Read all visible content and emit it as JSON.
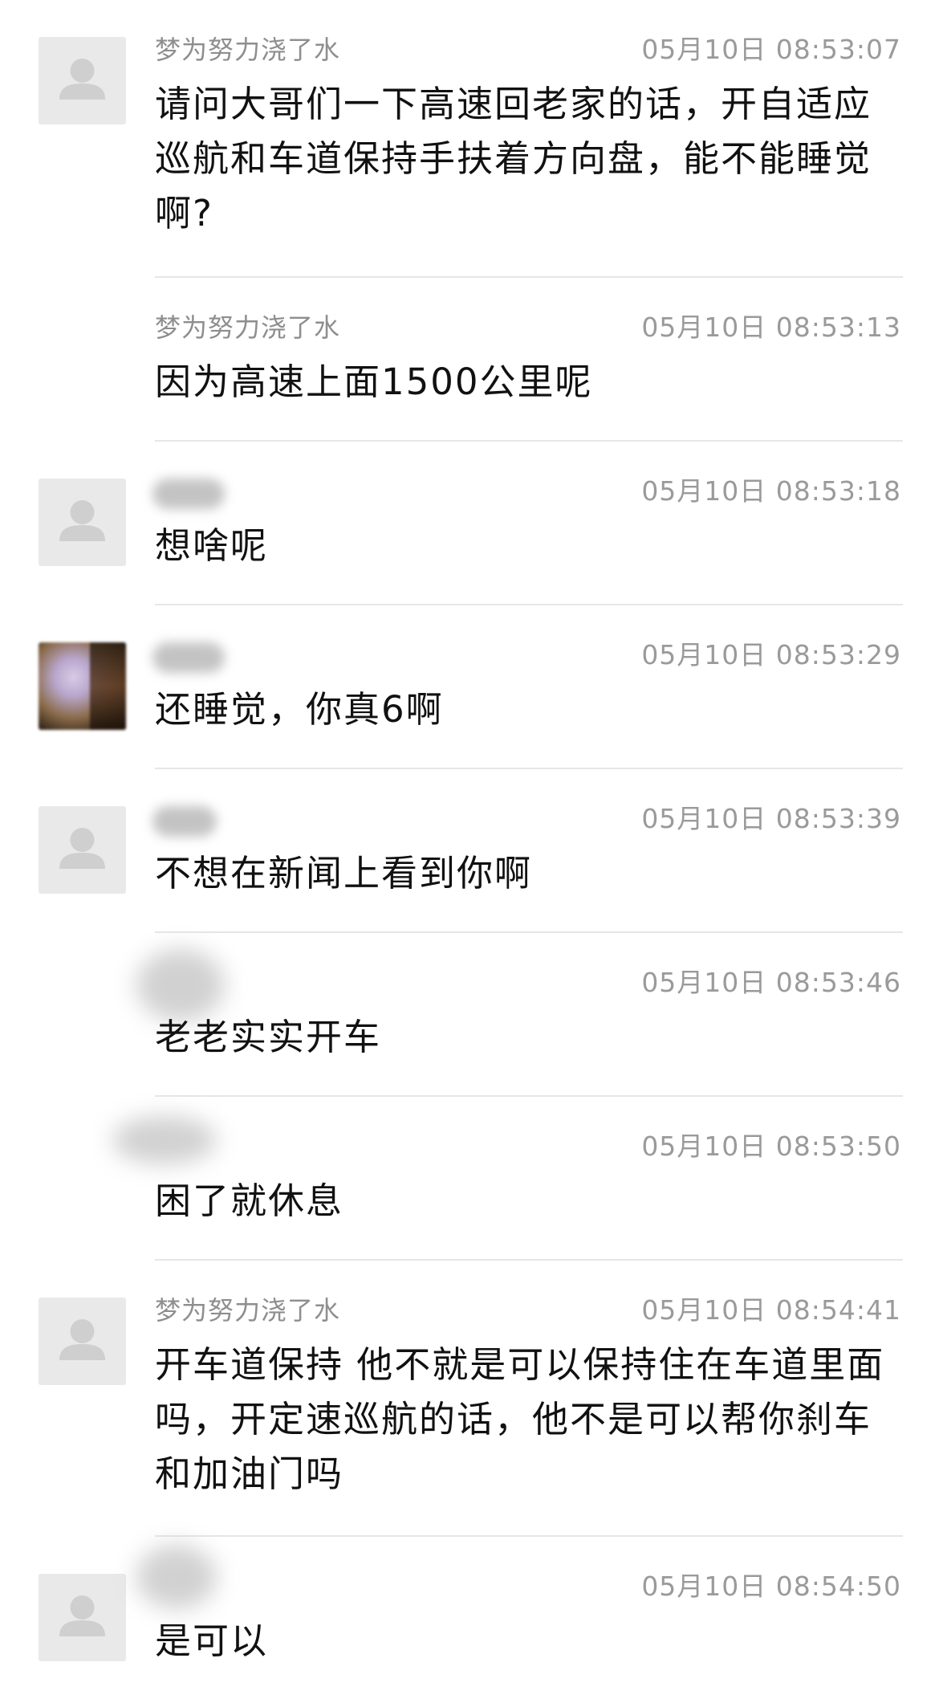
{
  "messages": [
    {
      "name": "梦为努力浇了水",
      "time": "05月10日 08:53:07",
      "text": "请问大哥们一下高速回老家的话，开自适应巡航和车道保持手扶着方向盘，能不能睡觉啊?",
      "avatar": "person-placeholder-icon"
    },
    {
      "name": "梦为努力浇了水",
      "time": "05月10日 08:53:13",
      "text": "因为高速上面1500公里呢",
      "avatar": "none"
    },
    {
      "name": "",
      "time": "05月10日 08:53:18",
      "text": "想啥呢",
      "avatar": "person-placeholder-icon"
    },
    {
      "name": "",
      "time": "05月10日 08:53:29",
      "text": "还睡觉，你真6啊",
      "avatar": "photo"
    },
    {
      "name": "",
      "time": "05月10日 08:53:39",
      "text": "不想在新闻上看到你啊",
      "avatar": "person-placeholder-icon"
    },
    {
      "name": "",
      "time": "05月10日 08:53:46",
      "text": "老老实实开车",
      "avatar": "blurred"
    },
    {
      "name": "",
      "time": "05月10日 08:53:50",
      "text": "困了就休息",
      "avatar": "blurred"
    },
    {
      "name": "梦为努力浇了水",
      "time": "05月10日 08:54:41",
      "text": "开车道保持 他不就是可以保持住在车道里面吗，开定速巡航的话，他不是可以帮你刹车和加油门吗",
      "avatar": "person-placeholder-icon"
    },
    {
      "name": "",
      "time": "05月10日 08:54:50",
      "text": "是可以",
      "avatar": "person-placeholder-icon"
    }
  ]
}
